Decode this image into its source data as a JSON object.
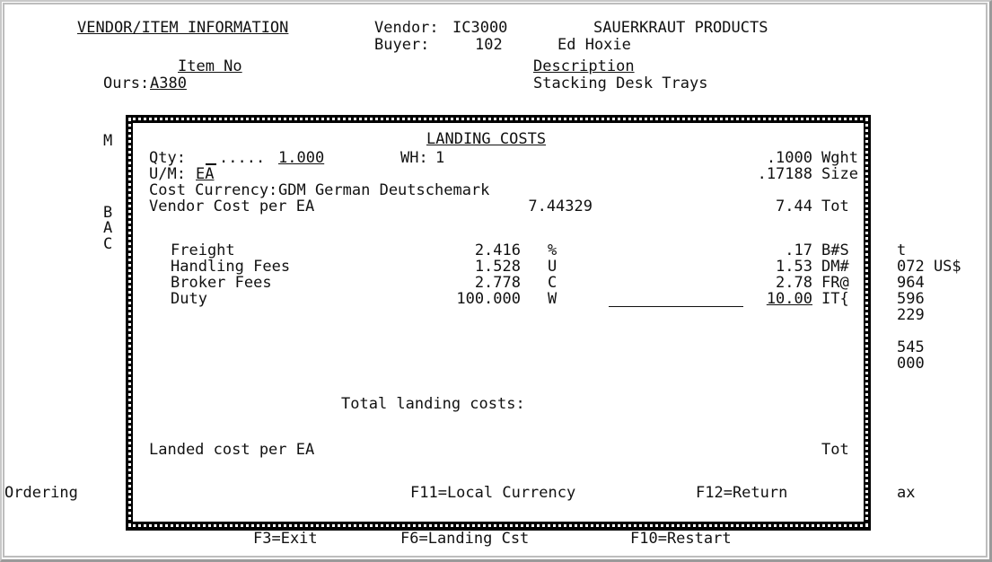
{
  "background": {
    "title": "VENDOR/ITEM INFORMATION",
    "vendor_label": "Vendor:",
    "vendor_code": "IC3000",
    "vendor_name": "SAUERKRAUT PRODUCTS",
    "buyer_label": "Buyer:",
    "buyer_code": "102",
    "buyer_name": "Ed Hoxie",
    "item_no_header": "Item No",
    "description_header": "Description",
    "ours_label": "Ours:",
    "ours_value": "A380",
    "description_value": "Stacking Desk Trays",
    "left_letters": [
      "M",
      "B",
      "A",
      "C"
    ],
    "ordering_label": "Ordering",
    "right_column": [
      "t",
      "072 US$",
      "964",
      "596",
      "229",
      "545",
      "000"
    ],
    "right_bottom": "ax",
    "function_keys": [
      "F3=Exit",
      "F6=Landing Cst",
      "F10=Restart"
    ]
  },
  "popup": {
    "title": "LANDING COSTS",
    "qty_label": "Qty:",
    "qty_value": "1.000",
    "qty_prefix_dots": ".....",
    "wh_label": "WH:",
    "wh_value": "1",
    "weight_value": ".1000",
    "weight_label": "Wght",
    "um_label": "U/M:",
    "um_value": "EA",
    "size_value": ".17188",
    "size_label": "Size",
    "currency_label": "Cost Currency:",
    "currency_value": "GDM German Deutschemark",
    "vendor_cost_label": "Vendor Cost per EA",
    "vendor_cost_value": "7.44329",
    "vendor_cost_total": "7.44",
    "tot_label": "Tot",
    "cost_rows": [
      {
        "name": "Freight",
        "rate": "2.416",
        "code": "%",
        "amount": ".17",
        "unit": "B#S"
      },
      {
        "name": "Handling Fees",
        "rate": "1.528",
        "code": "U",
        "amount": "1.53",
        "unit": "DM#"
      },
      {
        "name": "Broker Fees",
        "rate": "2.778",
        "code": "C",
        "amount": "2.78",
        "unit": "FR@"
      },
      {
        "name": "Duty",
        "rate": "100.000",
        "code": "W",
        "amount": "10.00",
        "unit": "IT{"
      }
    ],
    "total_landing_label": "Total landing costs:",
    "landed_cost_label": "Landed cost per EA",
    "landed_tot_label": "Tot",
    "function_keys": [
      "F11=Local Currency",
      "F12=Return"
    ]
  }
}
